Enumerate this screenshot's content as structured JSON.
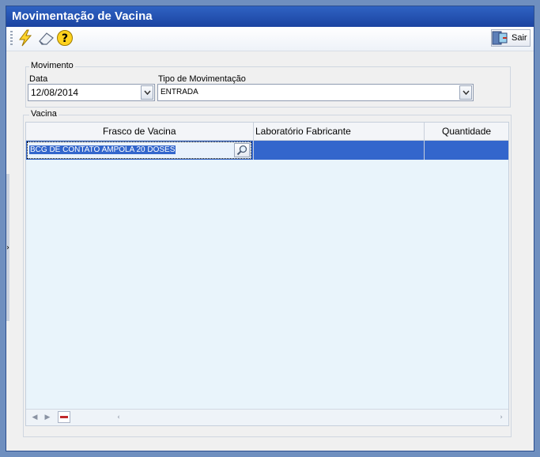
{
  "window": {
    "title": "Movimentação de Vacina"
  },
  "toolbar": {
    "exit_label": "Sair"
  },
  "movimento": {
    "group_label": "Movimento",
    "data_label": "Data",
    "data_value": "12/08/2014",
    "tipo_label": "Tipo de Movimentação",
    "tipo_value": "ENTRADA"
  },
  "vacina": {
    "group_label": "Vacina",
    "columns": [
      "Frasco de Vacina",
      "Laboratório Fabricante",
      "Quantidade"
    ],
    "rows": [
      {
        "frasco": "BCG DE CONTATO AMPOLA 20 DOSES",
        "laboratorio": "",
        "quantidade": ""
      }
    ]
  },
  "colors": {
    "title_bar": "#2f63c3",
    "selection": "#3366cc",
    "grid_bg": "#e9f4fb"
  }
}
